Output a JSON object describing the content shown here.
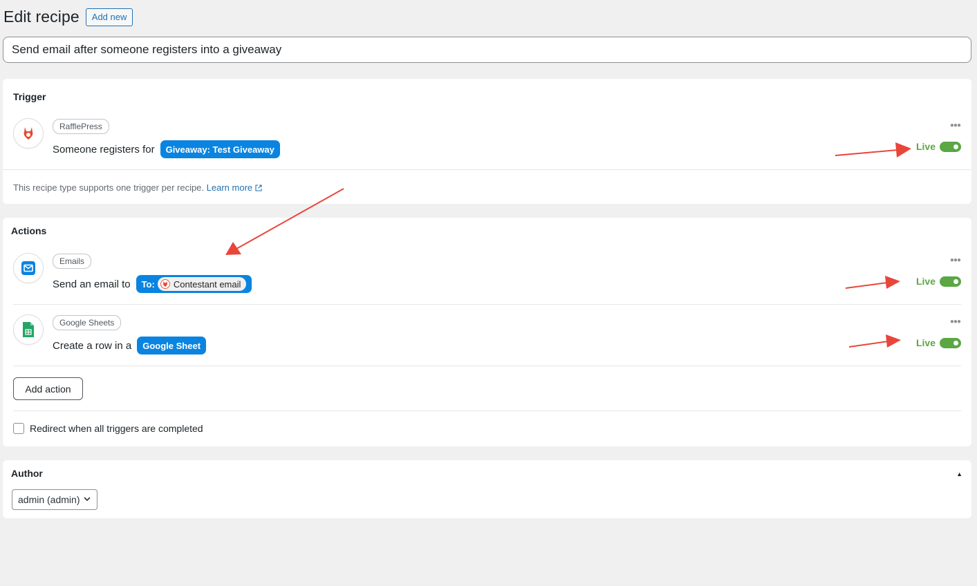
{
  "header": {
    "title": "Edit recipe",
    "add_new_label": "Add new"
  },
  "recipe_title": {
    "value": "Send email after someone registers into a giveaway"
  },
  "trigger_panel": {
    "title": "Trigger",
    "item": {
      "integration": "RafflePress",
      "sentence": "Someone registers for",
      "token": "Giveaway: Test Giveaway",
      "status": "Live",
      "icon": "rafflepress-icon"
    },
    "note": "This recipe type supports one trigger per recipe.",
    "learn_more": "Learn more"
  },
  "actions_panel": {
    "title": "Actions",
    "items": [
      {
        "integration": "Emails",
        "sentence": "Send an email to",
        "token_prefix": "To:",
        "token": "Contestant email",
        "status": "Live",
        "icon": "email-icon"
      },
      {
        "integration": "Google Sheets",
        "sentence": "Create a row in a",
        "token": "Google Sheet",
        "status": "Live",
        "icon": "google-sheets-icon"
      }
    ],
    "add_action_label": "Add action",
    "redirect_label": "Redirect when all triggers are completed"
  },
  "author_panel": {
    "title": "Author",
    "selected": "admin (admin)"
  },
  "colors": {
    "accent": "#0a84e0",
    "live": "#5aa744",
    "annotation_arrow": "#e8463a",
    "rafflepress": "#e8462e",
    "sheets": "#23a566"
  }
}
